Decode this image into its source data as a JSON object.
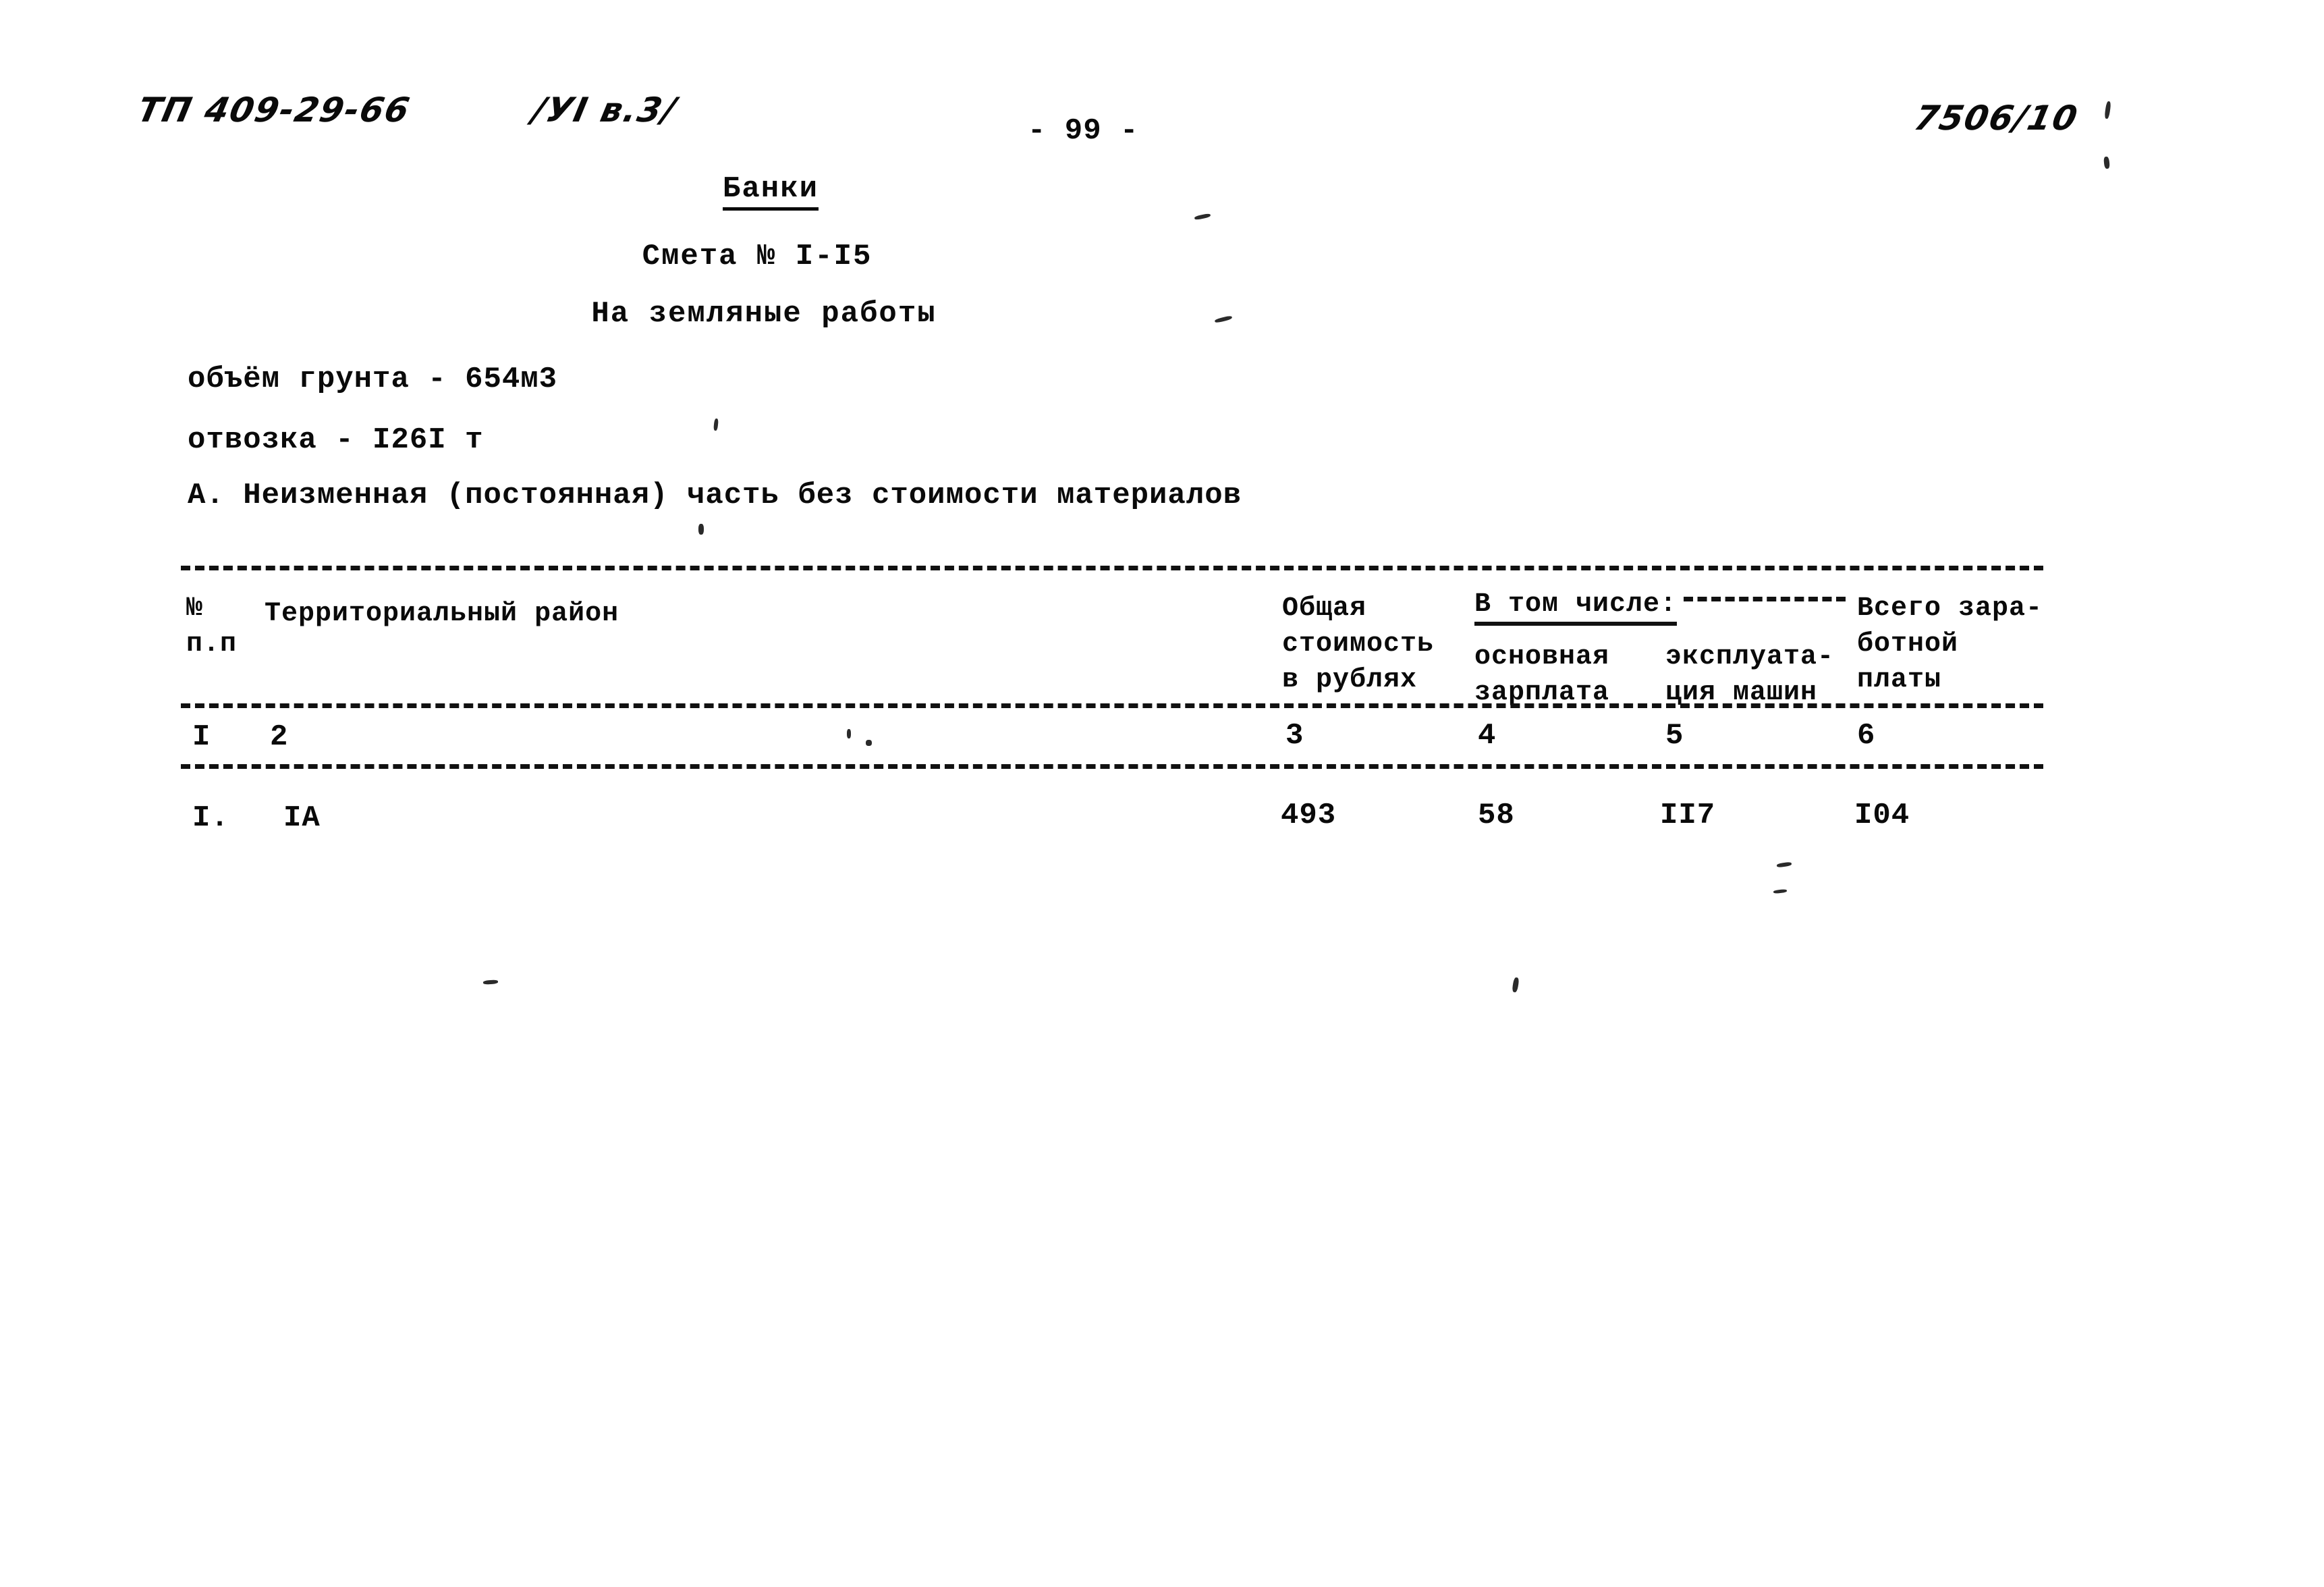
{
  "header": {
    "project_code": "ТП 409-29-66",
    "volume_ref": "/УI в.3/",
    "page_number": "- 99 -",
    "archive_code": "7506/10"
  },
  "titles": {
    "doc_title": "Банки",
    "estimate_no": "Смета № I-I5",
    "work_subject": "На земляные работы"
  },
  "parameters": [
    {
      "label": "объём грунта - 654м3"
    },
    {
      "label": "отвозка - I26I т"
    }
  ],
  "section": {
    "heading": "А. Неизменная (постоянная) часть без стоимости материалов"
  },
  "table": {
    "headers": {
      "no_line1": "№",
      "no_line2": "п.п",
      "region": "Территориальный район",
      "total_line1": "Общая",
      "total_line2": "стоимость",
      "total_line3": "в рублях",
      "inclusive": "В том числе:",
      "salary_line1": "основная",
      "salary_line2": "зарплата",
      "machines_line1": "эксплуата-",
      "machines_line2": "ция машин",
      "wages_line1": "Всего зара-",
      "wages_line2": "ботной",
      "wages_line3": "платы"
    },
    "column_numbers": {
      "c1": "I",
      "c2": "2",
      "c3": "3",
      "c4": "4",
      "c5": "5",
      "c6": "6"
    },
    "rows": [
      {
        "index": "I.",
        "region": "IА",
        "total_cost": "493",
        "basic_salary": "58",
        "machine_operation": "II7",
        "total_wages": "I04"
      }
    ]
  },
  "chart_data": {
    "type": "table",
    "title": "Смета № I-I5 — На земляные работы (Банки)",
    "categories": [
      "IА"
    ],
    "series": [
      {
        "name": "Общая стоимость в рублях",
        "values": [
          493
        ]
      },
      {
        "name": "основная зарплата",
        "values": [
          58
        ]
      },
      {
        "name": "эксплуатация машин",
        "values": [
          117
        ]
      },
      {
        "name": "Всего заработной платы",
        "values": [
          104
        ]
      }
    ]
  }
}
